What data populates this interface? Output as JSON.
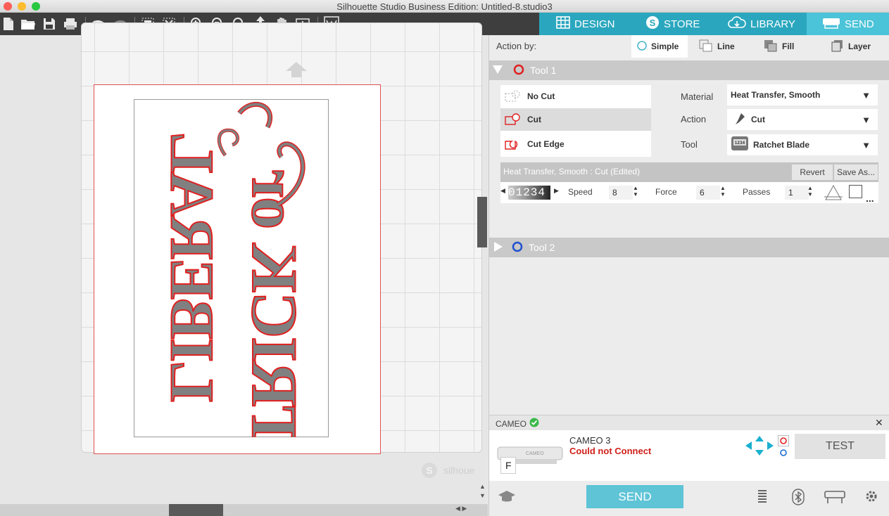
{
  "window": {
    "title": "Silhouette Studio Business Edition: Untitled-8.studio3"
  },
  "nav_tabs": [
    {
      "label": "DESIGN"
    },
    {
      "label": "STORE"
    },
    {
      "label": "LIBRARY"
    },
    {
      "label": "SEND"
    }
  ],
  "action_by": {
    "label": "Action by:",
    "options": [
      {
        "label": "Simple"
      },
      {
        "label": "Line"
      },
      {
        "label": "Fill"
      },
      {
        "label": "Layer"
      }
    ]
  },
  "tool1": {
    "title": "Tool 1",
    "cut_options": [
      {
        "label": "No Cut"
      },
      {
        "label": "Cut"
      },
      {
        "label": "Cut Edge"
      }
    ],
    "material_label": "Material",
    "material_value": "Heat Transfer, Smooth",
    "action_label": "Action",
    "action_value": "Cut",
    "tool_label": "Tool",
    "tool_value": "Ratchet Blade",
    "settings_title": "Heat Transfer, Smooth : Cut (Edited)",
    "revert_label": "Revert",
    "save_as_label": "Save As...",
    "blade_digits": "01234",
    "speed_label": "Speed",
    "speed_value": "8",
    "force_label": "Force",
    "force_value": "6",
    "passes_label": "Passes",
    "passes_value": "1",
    "more_label": "..."
  },
  "tool2": {
    "title": "Tool 2"
  },
  "device": {
    "section_label": "CAMEO",
    "name": "CAMEO 3",
    "status": "Could not Connect",
    "test_label": "TEST",
    "send_label": "SEND",
    "thumb_letter": "F",
    "thumb_text": "CAMEO"
  },
  "canvas": {
    "watermark": "silhoue",
    "design_text_left": "LIBERAL",
    "design_text_right": "TRICK or",
    "mat_color": "#f4f4f4",
    "cut_line_color": "#e05050"
  },
  "colors": {
    "accent_teal": "#2aa7be",
    "send_button": "#5ec4d6",
    "tool1_color": "#e02020",
    "tool2_color": "#2050d0",
    "status_error": "#d0201a"
  }
}
